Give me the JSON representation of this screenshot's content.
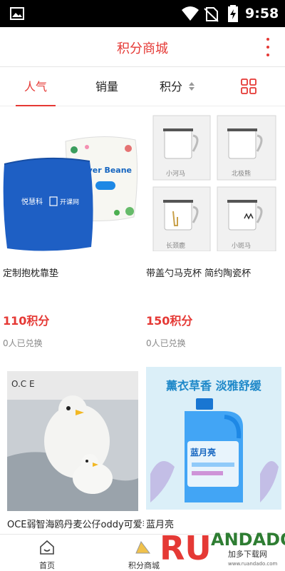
{
  "status_bar": {
    "time": "9:58",
    "icons": [
      "image-icon",
      "wifi-icon",
      "no-sim-icon",
      "battery-charging-icon"
    ]
  },
  "header": {
    "title": "积分商城",
    "menu_icon": "more-vertical-icon"
  },
  "tabs": [
    {
      "label": "人气",
      "active": true
    },
    {
      "label": "销量",
      "active": false
    },
    {
      "label": "积分",
      "active": false,
      "icon": "sort-arrows-icon"
    },
    {
      "label": "",
      "icon": "grid-view-icon"
    }
  ],
  "products": [
    {
      "name": "定制抱枕靠垫",
      "points": "110积分",
      "redeemed": "0人已兑换",
      "image_text": [
        "悦慧科",
        "开课网",
        "Lover Beane"
      ]
    },
    {
      "name": "带盖勺马克杯 简约陶瓷杯",
      "points": "150积分",
      "redeemed": "0人已兑换",
      "image_text": [
        "小河马",
        "北极熊",
        "长颈鹿",
        "小斑马"
      ]
    },
    {
      "name": "OCE弱智海鸥丹麦公仔oddy可爱毛绒玩具",
      "image_text": [
        "O.C E"
      ]
    },
    {
      "name": "蓝月亮",
      "image_text": [
        "薰衣草香 淡雅舒缓",
        "蓝月亮"
      ]
    }
  ],
  "bottom_nav": [
    {
      "label": "首页",
      "icon": "home-icon"
    },
    {
      "label": "积分商城",
      "icon": "mall-icon"
    }
  ],
  "watermark": {
    "text": "RUANDADO",
    "sub": "加多下载网",
    "url": "www.ruandado.com"
  },
  "colors": {
    "accent": "#e53935",
    "status_bar": "#000000"
  }
}
